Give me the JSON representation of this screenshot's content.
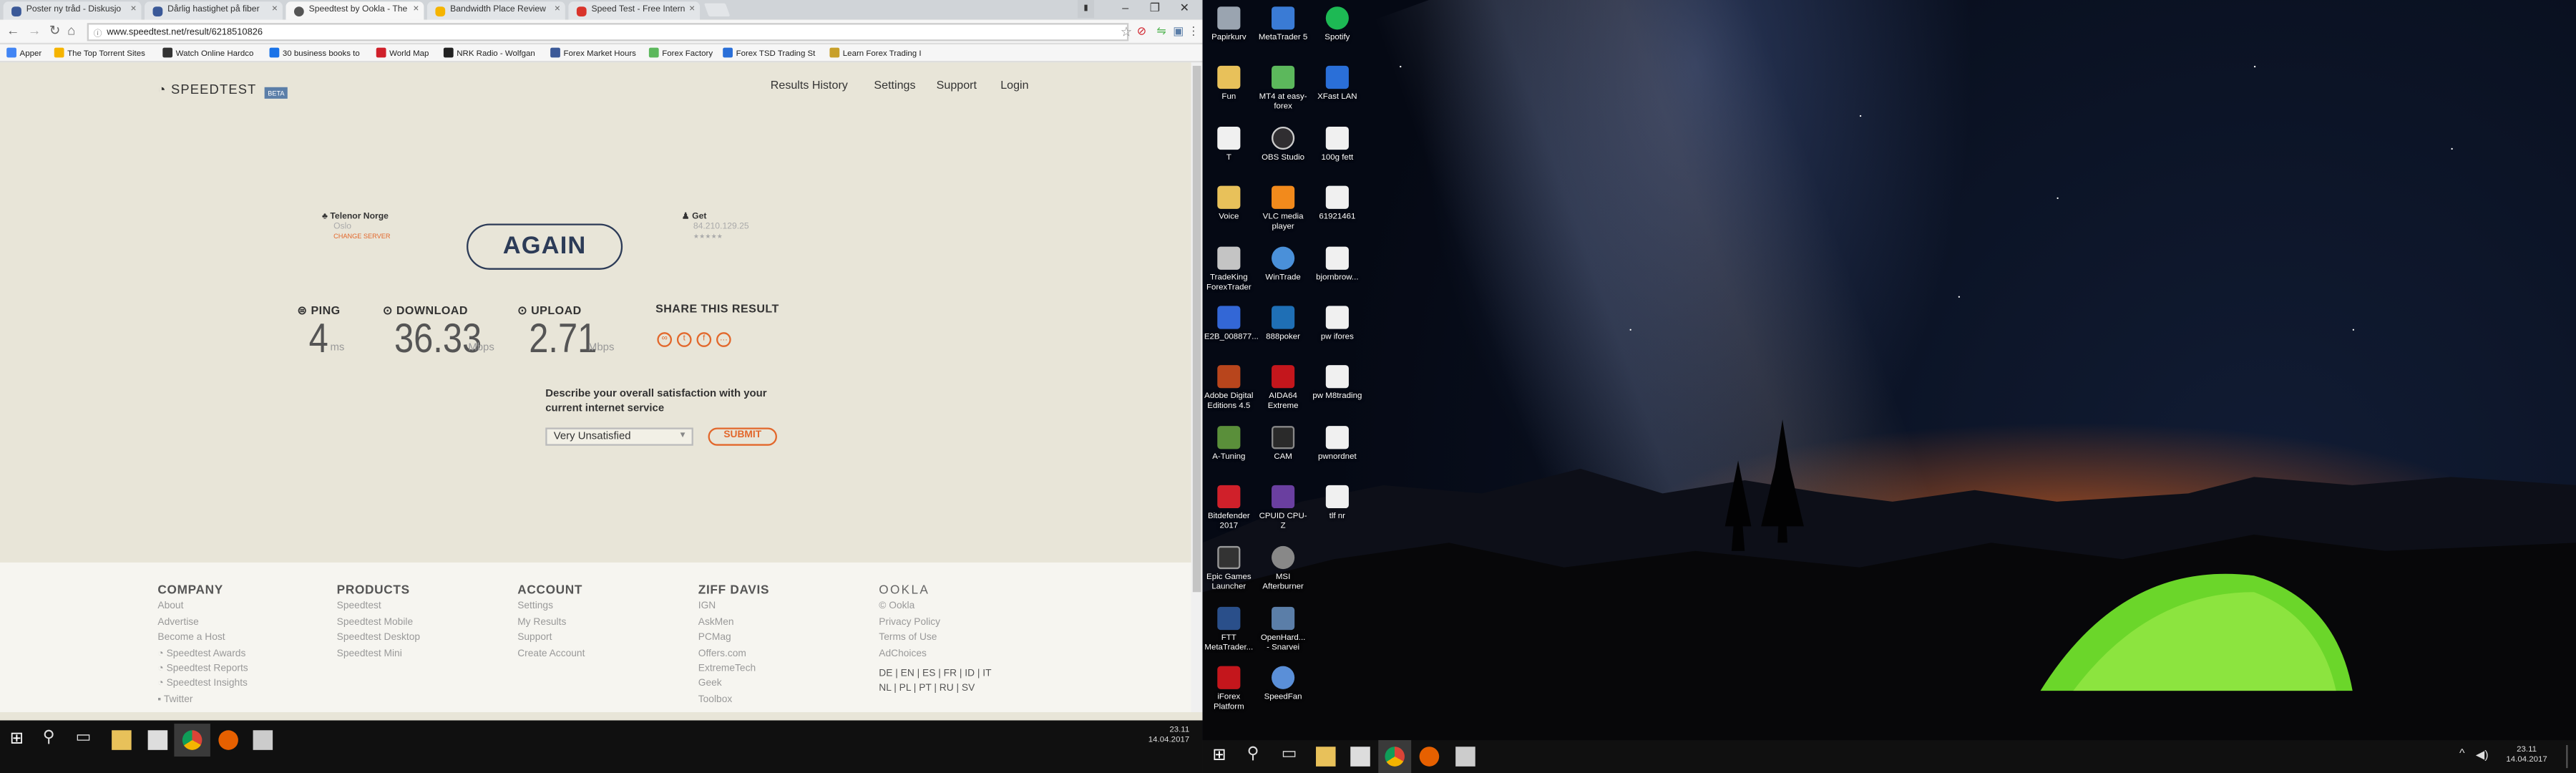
{
  "browser": {
    "tabs": [
      {
        "title": "Poster ny tråd - Diskusjo",
        "color": "#3b5998"
      },
      {
        "title": "Dårlig hastighet på fiber",
        "color": "#3b5998"
      },
      {
        "title": "Speedtest by Ookla - The",
        "color": "#444"
      },
      {
        "title": "Bandwidth Place Review",
        "color": "#f5b400"
      },
      {
        "title": "Speed Test - Free Intern",
        "color": "#d9342b"
      }
    ],
    "url": "www.speedtest.net/result/6218510826",
    "bookmarks": [
      "Apper",
      "The Top Torrent Sites",
      "Watch Online Hardco",
      "30 business books to",
      "World Map",
      "NRK Radio - Wolfgan",
      "Forex Market Hours",
      "Forex Factory",
      "Forex TSD Trading St",
      "Learn Forex Trading I"
    ]
  },
  "speedtest": {
    "logo": "SPEEDTEST",
    "beta": "BETA",
    "nav": [
      "Results History",
      "Settings",
      "Support",
      "Login"
    ],
    "isp": {
      "name": "Telenor Norge",
      "city": "Oslo",
      "change": "CHANGE SERVER"
    },
    "client": {
      "name": "Get",
      "ip": "84.210.129.25",
      "stars": "★★★★★"
    },
    "again": "AGAIN",
    "ping": {
      "label": "PING",
      "value": "4",
      "unit": "ms"
    },
    "download": {
      "label": "DOWNLOAD",
      "value": "36.33",
      "unit": "Mbps"
    },
    "upload": {
      "label": "UPLOAD",
      "value": "2.71",
      "unit": "Mbps"
    },
    "share": "SHARE THIS RESULT",
    "question": "Describe your overall satisfaction with your current internet service",
    "select": "Very Unsatisfied",
    "submit": "SUBMIT"
  },
  "footer": {
    "company": {
      "title": "COMPANY",
      "items": [
        "About",
        "Advertise",
        "Become a Host",
        "Speedtest Awards",
        "Speedtest Reports",
        "Speedtest Insights",
        "Twitter"
      ]
    },
    "products": {
      "title": "PRODUCTS",
      "items": [
        "Speedtest",
        "Speedtest Mobile",
        "Speedtest Desktop",
        "Speedtest Mini"
      ]
    },
    "account": {
      "title": "ACCOUNT",
      "items": [
        "Settings",
        "My Results",
        "Support",
        "Create Account"
      ]
    },
    "ziff": {
      "title": "ZIFF DAVIS",
      "items": [
        "IGN",
        "AskMen",
        "PCMag",
        "Offers.com",
        "ExtremeTech",
        "Geek",
        "Toolbox"
      ]
    },
    "ookla": {
      "title": "OOKLA",
      "items": [
        "© Ookla",
        "Privacy Policy",
        "Terms of Use",
        "AdChoices"
      ],
      "langs1": "DE | EN | ES | FR | ID | IT",
      "langs2": "NL | PL | PT | RU | SV"
    }
  },
  "taskbar": {
    "time": "23.11",
    "date": "14.04.2017"
  },
  "desktop_icons": [
    {
      "label": "Papirkurv",
      "color": "#9aa4b0"
    },
    {
      "label": "MetaTrader 5",
      "color": "#3a7bd5"
    },
    {
      "label": "Spotify",
      "color": "#1db954"
    },
    {
      "label": "Fun",
      "color": "#e8c15a"
    },
    {
      "label": "MT4 at easy-forex",
      "color": "#5cb85c"
    },
    {
      "label": "XFast LAN",
      "color": "#2a6fd8"
    },
    {
      "label": "T",
      "color": "#f0f0f0"
    },
    {
      "label": "OBS Studio",
      "color": "#302e31"
    },
    {
      "label": "100g fett",
      "color": "#f0f0f0"
    },
    {
      "label": "Voice",
      "color": "#e8c15a"
    },
    {
      "label": "VLC media player",
      "color": "#f28a1c"
    },
    {
      "label": "61921461",
      "color": "#f0f0f0"
    },
    {
      "label": "TradeKing ForexTrader",
      "color": "#c4c4c4"
    },
    {
      "label": "WinTrade",
      "color": "#4a90d9"
    },
    {
      "label": "bjornbrow...",
      "color": "#f0f0f0"
    },
    {
      "label": "E2B_008877...",
      "color": "#3367d6"
    },
    {
      "label": "888poker",
      "color": "#1f6fb5"
    },
    {
      "label": "pw ifores",
      "color": "#f0f0f0"
    },
    {
      "label": "Adobe Digital Editions 4.5",
      "color": "#b8451c"
    },
    {
      "label": "AIDA64 Extreme",
      "color": "#c4161c"
    },
    {
      "label": "pw M8trading",
      "color": "#f0f0f0"
    },
    {
      "label": "A-Tuning",
      "color": "#5a8f3a"
    },
    {
      "label": "CAM",
      "color": "#2a2a2a"
    },
    {
      "label": "pwnordnet",
      "color": "#f0f0f0"
    },
    {
      "label": "Bitdefender 2017",
      "color": "#d0202a"
    },
    {
      "label": "CPUID CPU-Z",
      "color": "#6a3fa0"
    },
    {
      "label": "tlf nr",
      "color": "#f0f0f0"
    },
    {
      "label": "Epic Games Launcher",
      "color": "#333"
    },
    {
      "label": "MSI Afterburner",
      "color": "#888"
    },
    {
      "label": "FTT MetaTrader...",
      "color": "#2a4f8a"
    },
    {
      "label": "OpenHard... - Snarvei",
      "color": "#5b7ea8"
    },
    {
      "label": "iForex Platform",
      "color": "#c4161c"
    },
    {
      "label": "SpeedFan",
      "color": "#5a8fd8"
    }
  ]
}
